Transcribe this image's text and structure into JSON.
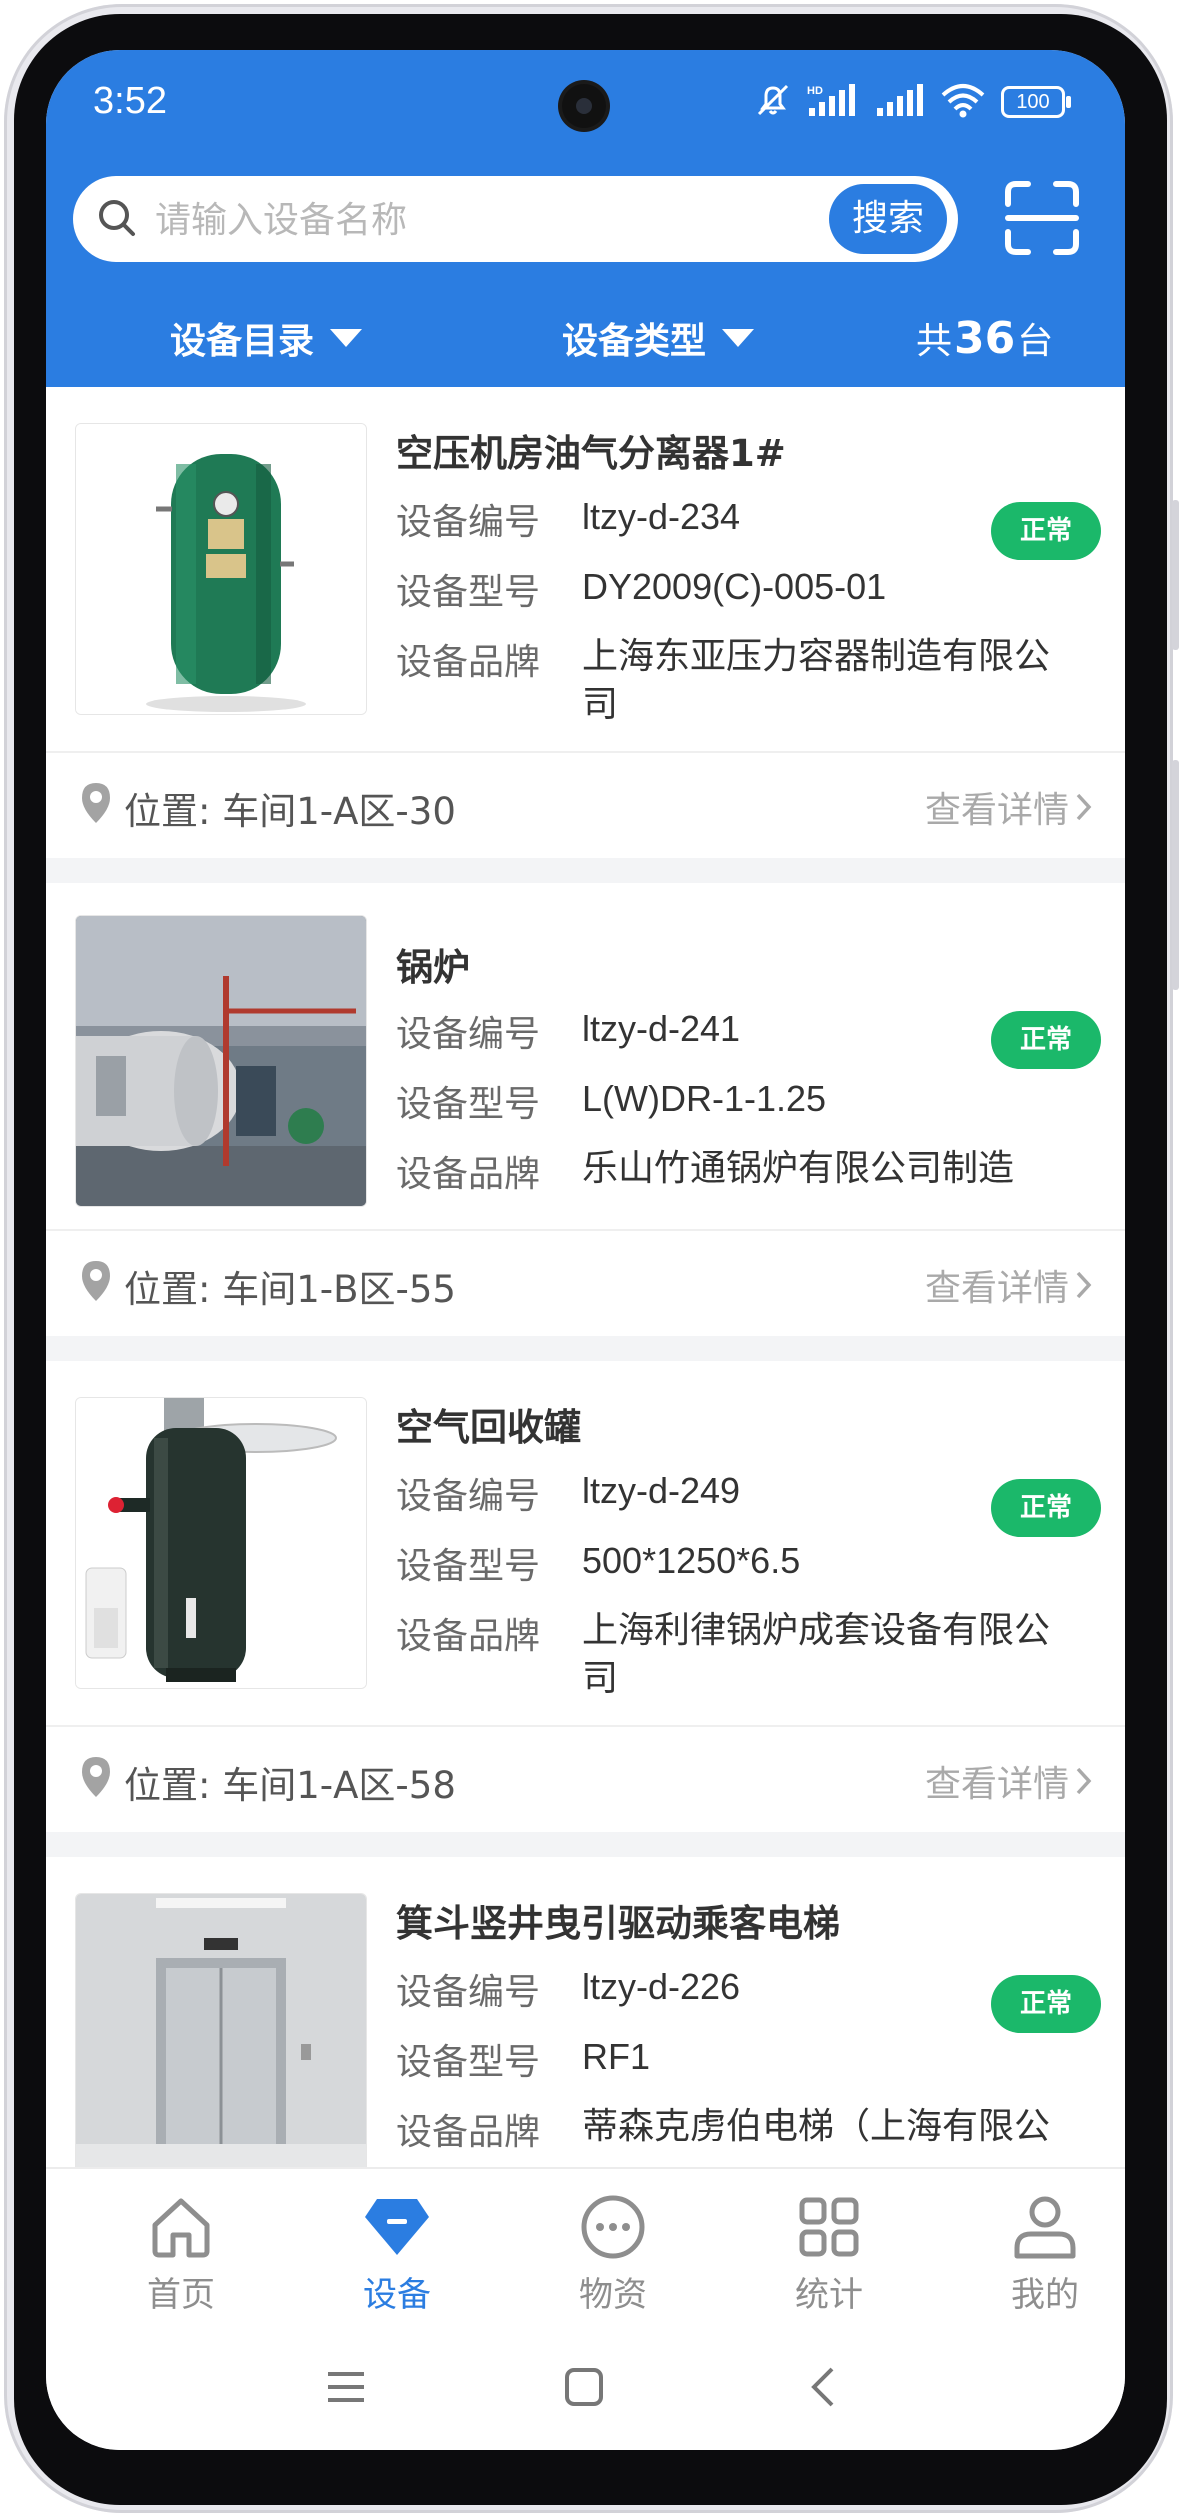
{
  "status_bar": {
    "time": "3:52",
    "battery": "100"
  },
  "header": {
    "search": {
      "placeholder": "请输入设备名称",
      "button_label": "搜索"
    },
    "filters": {
      "catalog": "设备目录",
      "type": "设备类型",
      "total_prefix": "共",
      "total_count": "36",
      "total_suffix": "台"
    }
  },
  "field_labels": {
    "code": "设备编号",
    "model": "设备型号",
    "brand": "设备品牌"
  },
  "detail_link": "查看详情",
  "devices": [
    {
      "name": "空压机房油气分离器1#",
      "code": "ltzy-d-234",
      "model": "DY2009(C)-005-01",
      "brand_line1": "上海东亚压力容器制造有限公",
      "brand_line2": "司",
      "status": "正常",
      "location": "位置: 车间1-A区-30",
      "image": "green-tank-image"
    },
    {
      "name": "锅炉",
      "code": "ltzy-d-241",
      "model": "L(W)DR-1-1.25",
      "brand_line1": "乐山竹通锅炉有限公司制造",
      "brand_line2": "",
      "status": "正常",
      "location": "位置: 车间1-B区-55",
      "image": "boiler-room-image"
    },
    {
      "name": "空气回收罐",
      "code": "ltzy-d-249",
      "model": "500*1250*6.5",
      "brand_line1": "上海利律锅炉成套设备有限公",
      "brand_line2": "司",
      "status": "正常",
      "location": "位置: 车间1-A区-58",
      "image": "dark-tank-image"
    },
    {
      "name": "箕斗竖井曳引驱动乘客电梯",
      "code": "ltzy-d-226",
      "model": "RF1",
      "brand_line1": "蒂森克虏伯电梯（上海有限公",
      "brand_line2": "",
      "status": "正常",
      "image": "elevator-image"
    }
  ],
  "tabs": [
    {
      "label": "首页",
      "icon": "home-icon"
    },
    {
      "label": "设备",
      "icon": "diamond-icon"
    },
    {
      "label": "物资",
      "icon": "more-circle-icon"
    },
    {
      "label": "统计",
      "icon": "grid-icon"
    },
    {
      "label": "我的",
      "icon": "user-icon"
    }
  ],
  "active_tab": "设备",
  "colors": {
    "primary": "#2b7de1",
    "status_ok": "#1bb86a"
  }
}
